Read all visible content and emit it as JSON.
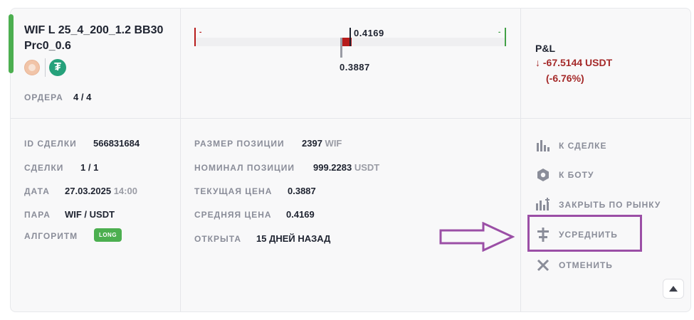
{
  "deal": {
    "title": "WIF L 25_4_200_1.2 BB30 Prc0_0.6",
    "orders_label": "ОРДЕРА",
    "orders_value": "4 / 4"
  },
  "chart": {
    "left_marker": "-",
    "right_marker": "-",
    "avg_price_label": "0.4169",
    "current_price_label": "0.3887"
  },
  "pnl": {
    "title": "P&L",
    "value": "↓ -67.5144 USDT",
    "percent": "(-6.76%)",
    "color": "#a52a2a"
  },
  "details_left": {
    "id_label": "ID СДЕЛКИ",
    "id_value": "566831684",
    "deals_label": "СДЕЛКИ",
    "deals_value": "1 / 1",
    "date_label": "ДАТА",
    "date_value": "27.03.2025",
    "time_value": "14:00",
    "pair_label": "ПАРА",
    "pair_value": "WIF / USDT",
    "algo_label": "АЛГОРИТМ",
    "algo_value": "LONG"
  },
  "details_mid": {
    "size_label": "РАЗМЕР ПОЗИЦИИ",
    "size_value": "2397",
    "size_unit": "WIF",
    "nominal_label": "НОМИНАЛ ПОЗИЦИИ",
    "nominal_value": "999.2283",
    "nominal_unit": "USDT",
    "cur_label": "ТЕКУЩАЯ ЦЕНА",
    "cur_value": "0.3887",
    "avg_label": "СРЕДНЯЯ ЦЕНА",
    "avg_value": "0.4169",
    "open_label": "ОТКРЫТА",
    "open_value": "15 ДНЕЙ НАЗАД"
  },
  "actions": {
    "to_deal": "К СДЕЛКЕ",
    "to_bot": "К БОТУ",
    "close_market": "ЗАКРЫТЬ ПО РЫНКУ",
    "average": "УСРЕДНИТЬ",
    "cancel": "ОТМЕНИТЬ"
  },
  "colors": {
    "green": "#4caf50",
    "red": "#b71c1c",
    "annotation": "#9b4fa6"
  }
}
